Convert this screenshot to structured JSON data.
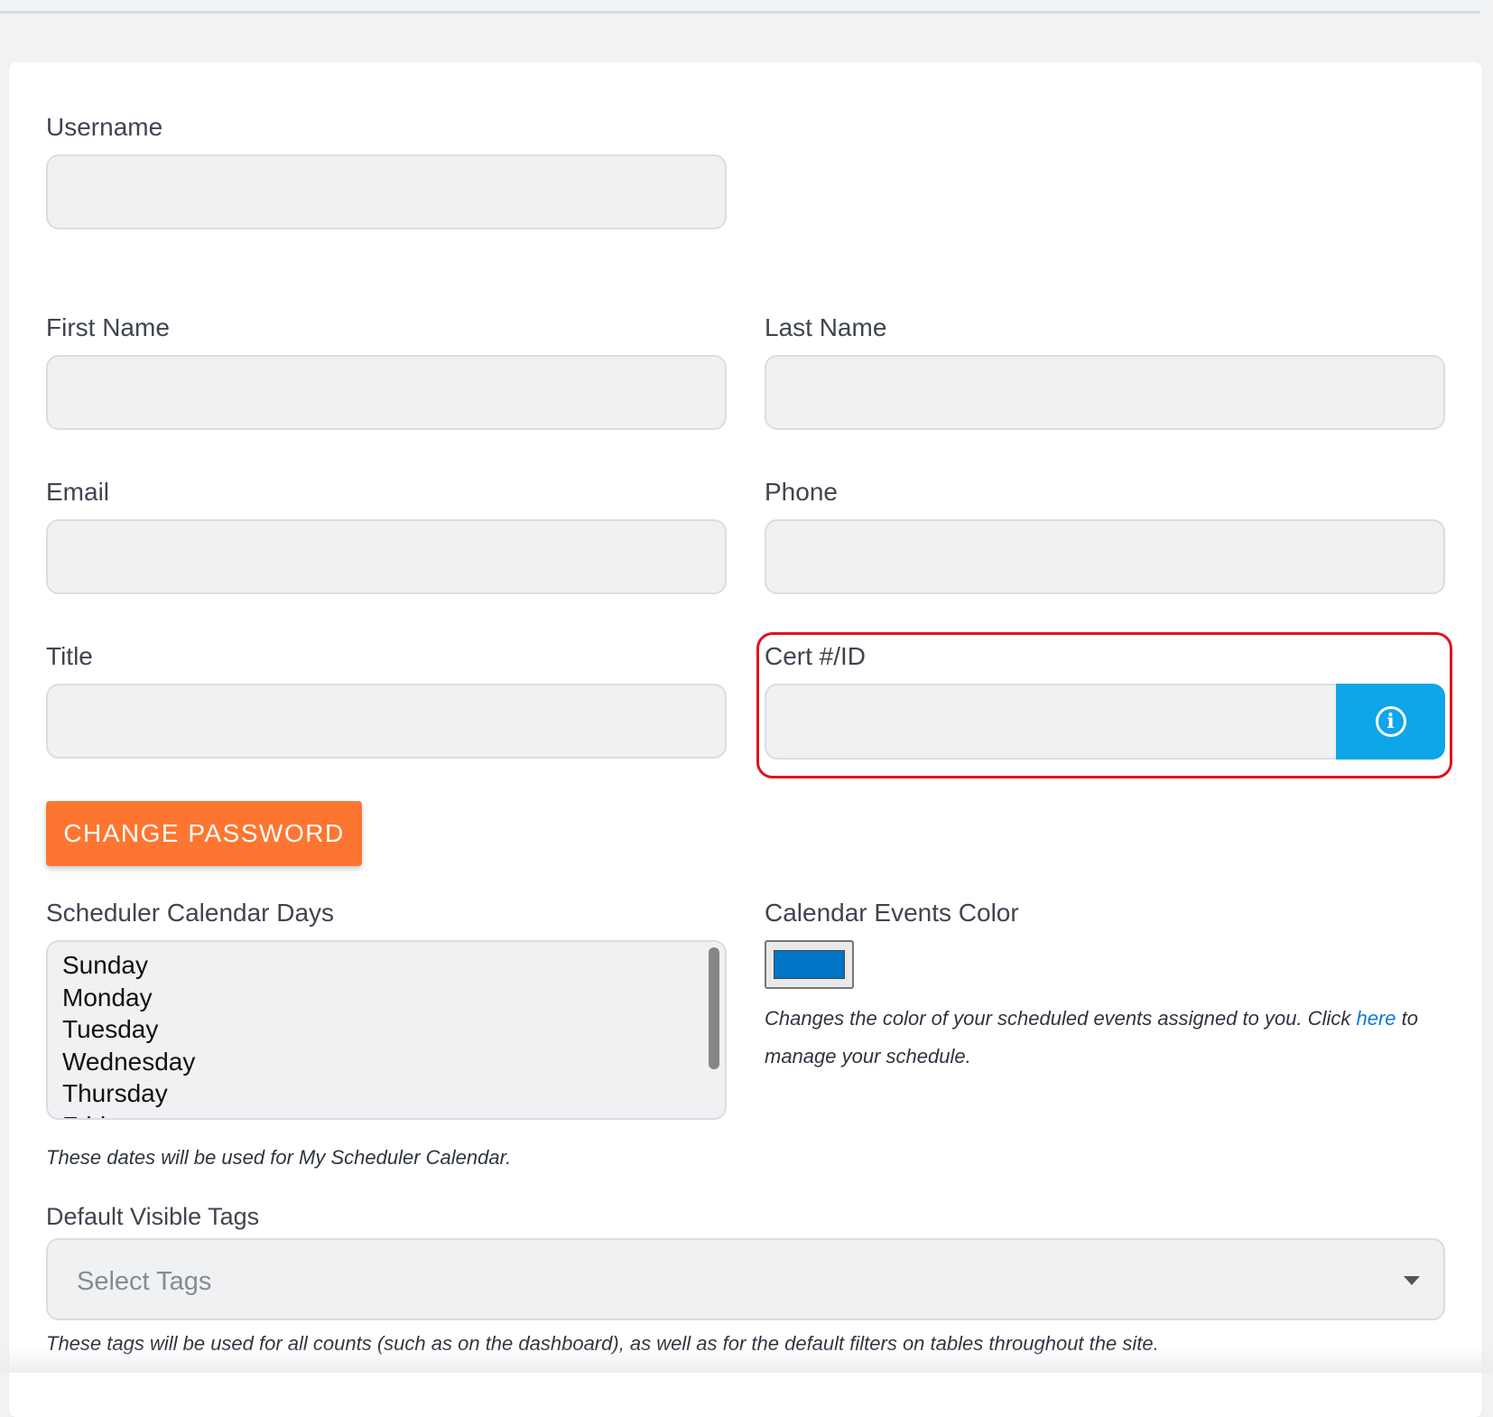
{
  "form": {
    "username_label": "Username",
    "first_name_label": "First Name",
    "last_name_label": "Last Name",
    "email_label": "Email",
    "phone_label": "Phone",
    "title_label": "Title",
    "cert_label": "Cert #/ID",
    "cert_button_icon": "info-circle-icon",
    "change_password_label": "CHANGE PASSWORD",
    "scheduler_days_label": "Scheduler Calendar Days",
    "scheduler_days_options": [
      "Sunday",
      "Monday",
      "Tuesday",
      "Wednesday",
      "Thursday",
      "Friday"
    ],
    "scheduler_days_help": "These dates will be used for My Scheduler Calendar.",
    "events_color_label": "Calendar Events Color",
    "events_color_value": "#0174c8",
    "events_color_help_before": "Changes the color of your scheduled events assigned to you. Click ",
    "events_color_help_link": "here",
    "events_color_help_after": " to manage your schedule.",
    "tags_label": "Default Visible Tags",
    "tags_placeholder": "Select Tags",
    "tags_help": "These tags will be used for all counts (such as on the dashboard), as well as for the default filters on tables throughout the site."
  },
  "colors": {
    "accent_orange": "#fd7631",
    "info_blue": "#0ea5e9",
    "highlight_red": "#e2111a",
    "link_blue": "#0f7ad8"
  }
}
